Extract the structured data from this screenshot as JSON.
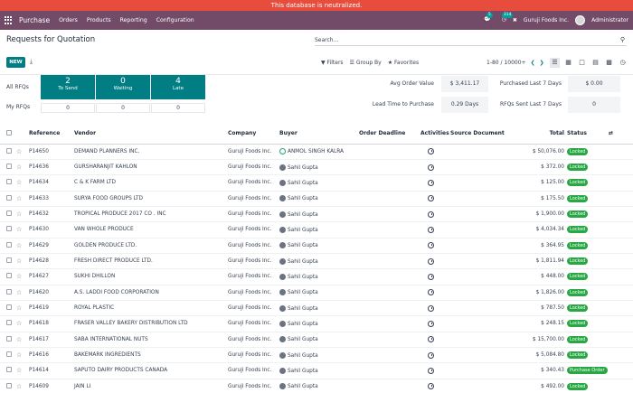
{
  "banner": "This database is neutralized.",
  "nav": {
    "brand": "Purchase",
    "menus": [
      "Orders",
      "Products",
      "Reporting",
      "Configuration"
    ],
    "msg_count": "5",
    "activity_count": "314",
    "company": "Guruji Foods Inc.",
    "user": "Administrator"
  },
  "cp": {
    "title": "Requests for Quotation",
    "search_placeholder": "Search...",
    "new_label": "NEW",
    "filters": "Filters",
    "group_by": "Group By",
    "favorites": "Favorites",
    "pager": "1-80 / 10000+"
  },
  "dash": {
    "all_rfqs": "All RFQs",
    "my_rfqs": "My RFQs",
    "tiles": [
      {
        "n": "2",
        "l": "To Send",
        "my": "0"
      },
      {
        "n": "0",
        "l": "Waiting",
        "my": "0"
      },
      {
        "n": "4",
        "l": "Late",
        "my": "0"
      }
    ],
    "kpis": [
      {
        "label": "Avg Order Value",
        "value": "$ 3,411.17"
      },
      {
        "label": "Purchased Last 7 Days",
        "value": "$ 0.00"
      },
      {
        "label": "Lead Time to Purchase",
        "value": "0.29 Days"
      },
      {
        "label": "RFQs Sent Last 7 Days",
        "value": "0"
      }
    ]
  },
  "table": {
    "headers": [
      "Reference",
      "Vendor",
      "Company",
      "Buyer",
      "Order Deadline",
      "Activities",
      "Source Document",
      "Total",
      "Status"
    ],
    "rows": [
      {
        "ref": "P14650",
        "vendor": "DEMAND PLANNERS INC.",
        "company": "Guruji Foods Inc.",
        "buyer": "ANMOL SINGH KALRA",
        "total": "$ 50,076.00",
        "status": "Locked"
      },
      {
        "ref": "P14636",
        "vendor": "GURSHARANJIT KAHLON",
        "company": "Guruji Foods Inc.",
        "buyer": "Sahil Gupta",
        "total": "$ 372.00",
        "status": "Locked"
      },
      {
        "ref": "P14634",
        "vendor": "C & K FARM LTD",
        "company": "Guruji Foods Inc.",
        "buyer": "Sahil Gupta",
        "total": "$ 125.00",
        "status": "Locked"
      },
      {
        "ref": "P14633",
        "vendor": "SURYA FOOD GROUPS LTD",
        "company": "Guruji Foods Inc.",
        "buyer": "Sahil Gupta",
        "total": "$ 175.50",
        "status": "Locked"
      },
      {
        "ref": "P14632",
        "vendor": "TROPICAL PRODUCE 2017 CO . INC",
        "company": "Guruji Foods Inc.",
        "buyer": "Sahil Gupta",
        "total": "$ 1,900.00",
        "status": "Locked"
      },
      {
        "ref": "P14630",
        "vendor": "VAN WHOLE PRODUCE",
        "company": "Guruji Foods Inc.",
        "buyer": "Sahil Gupta",
        "total": "$ 4,034.34",
        "status": "Locked"
      },
      {
        "ref": "P14629",
        "vendor": "GOLDEN PRODUCE LTD.",
        "company": "Guruji Foods Inc.",
        "buyer": "Sahil Gupta",
        "total": "$ 364.95",
        "status": "Locked"
      },
      {
        "ref": "P14628",
        "vendor": "FRESH DIRECT PRODUCE LTD.",
        "company": "Guruji Foods Inc.",
        "buyer": "Sahil Gupta",
        "total": "$ 1,811.94",
        "status": "Locked"
      },
      {
        "ref": "P14627",
        "vendor": "SUKHI DHILLON",
        "company": "Guruji Foods Inc.",
        "buyer": "Sahil Gupta",
        "total": "$ 448.00",
        "status": "Locked"
      },
      {
        "ref": "P14620",
        "vendor": "A.S. LADDI FOOD CORPORATION",
        "company": "Guruji Foods Inc.",
        "buyer": "Sahil Gupta",
        "total": "$ 1,826.00",
        "status": "Locked"
      },
      {
        "ref": "P14619",
        "vendor": "ROYAL PLASTIC",
        "company": "Guruji Foods Inc.",
        "buyer": "Sahil Gupta",
        "total": "$ 787.50",
        "status": "Locked"
      },
      {
        "ref": "P14618",
        "vendor": "FRASER VALLEY BAKERY DISTRIBUTION LTD",
        "company": "Guruji Foods Inc.",
        "buyer": "Sahil Gupta",
        "total": "$ 248.15",
        "status": "Locked"
      },
      {
        "ref": "P14617",
        "vendor": "SABA INTERNATIONAL NUTS",
        "company": "Guruji Foods Inc.",
        "buyer": "Sahil Gupta",
        "total": "$ 15,700.00",
        "status": "Locked"
      },
      {
        "ref": "P14616",
        "vendor": "BAKEMARK INGREDIENTS",
        "company": "Guruji Foods Inc.",
        "buyer": "Sahil Gupta",
        "total": "$ 5,084.80",
        "status": "Locked"
      },
      {
        "ref": "P14614",
        "vendor": "SAPUTO DAIRY PRODUCTS CANADA",
        "company": "Guruji Foods Inc.",
        "buyer": "Sahil Gupta",
        "total": "$ 340.43",
        "status": "Purchase Order"
      },
      {
        "ref": "P14609",
        "vendor": "JAIN LI",
        "company": "Guruji Foods Inc.",
        "buyer": "Sahil Gupta",
        "total": "$ 492.00",
        "status": "Locked"
      }
    ]
  },
  "colors": {
    "banner": "#e74c3c",
    "navbar": "#714b67",
    "primary": "#017e84",
    "status": "#28a745"
  },
  "icons": [
    "apps-icon",
    "chat-icon",
    "clock-icon",
    "tools-icon",
    "search-icon",
    "download-icon",
    "filter-icon",
    "layers-icon",
    "star-icon"
  ]
}
